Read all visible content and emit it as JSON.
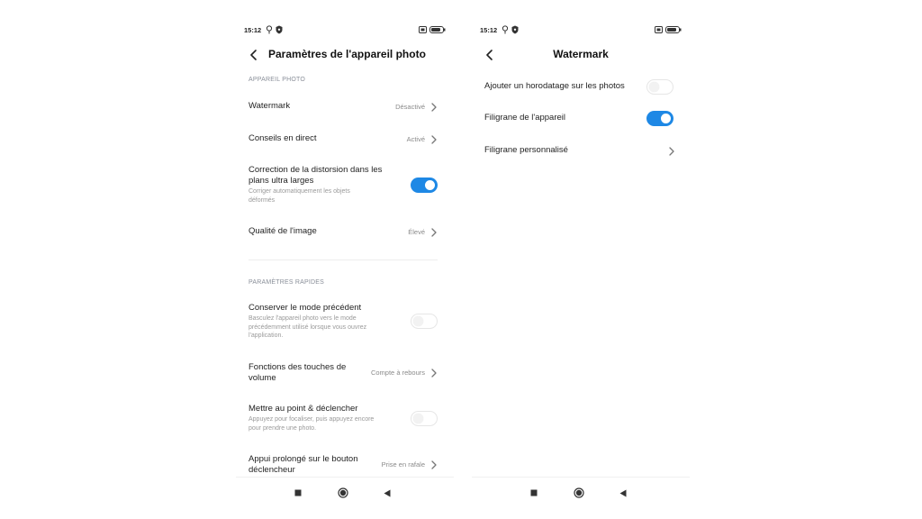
{
  "status_bar": {
    "time": "15:12"
  },
  "camera_settings": {
    "title": "Paramètres de l'appareil photo",
    "section_camera": "APPAREIL PHOTO",
    "watermark": {
      "label": "Watermark",
      "value": "Désactivé"
    },
    "live_tips": {
      "label": "Conseils en direct",
      "value": "Activé"
    },
    "distortion": {
      "label_line1": "Correction de la distorsion dans les",
      "label_line2": "plans ultra larges",
      "sub_line1": "Corriger automatiquement les objets",
      "sub_line2": "déformés",
      "enabled": true
    },
    "image_quality": {
      "label": "Qualité de l'image",
      "value": "Élevé"
    },
    "section_quick": "PARAMÈTRES RAPIDES",
    "keep_mode": {
      "label": "Conserver le mode précédent",
      "sub_line1": "Basculez l'appareil photo vers le mode",
      "sub_line2": "précédemment utilisé lorsque vous ouvrez",
      "sub_line3": "l'application.",
      "enabled": false
    },
    "volume_keys": {
      "label_line1": "Fonctions des touches de",
      "label_line2": "volume",
      "value": "Compte à rebours"
    },
    "focus_shoot": {
      "label": "Mettre au point & déclencher",
      "sub_line1": "Appuyez pour focaliser, puis appuyez encore",
      "sub_line2": "pour prendre une photo.",
      "enabled": false
    },
    "long_press": {
      "label_line1": "Appui prolongé sur le bouton",
      "label_line2": "déclencheur",
      "value": "Prise en rafale"
    }
  },
  "watermark_page": {
    "title": "Watermark",
    "timestamp": {
      "label": "Ajouter un horodatage sur les photos",
      "enabled": false
    },
    "device_watermark": {
      "label": "Filigrane de l'appareil",
      "enabled": true
    },
    "custom_watermark": {
      "label": "Filigrane personnalisé"
    }
  },
  "colors": {
    "accent": "#1e88e5",
    "section_header": "#8a8f99",
    "secondary_text": "#8a8a8a"
  }
}
